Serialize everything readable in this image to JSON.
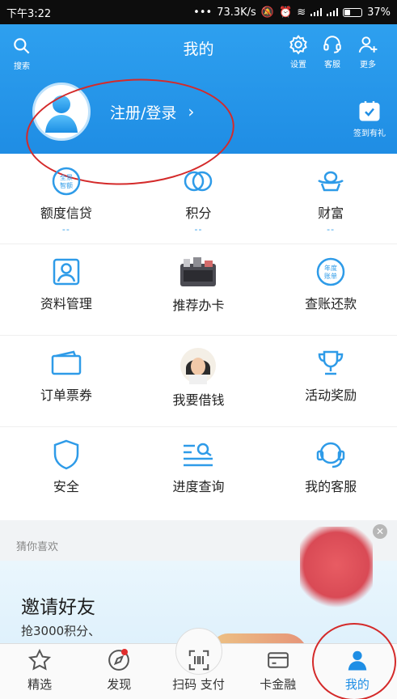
{
  "status_bar": {
    "time": "下午3:22",
    "speed": "73.3K/s",
    "battery": "37%"
  },
  "header": {
    "title": "我的",
    "search_label": "搜索",
    "settings_label": "设置",
    "service_label": "客服",
    "more_label": "更多",
    "login_text": "注册/登录",
    "checkin_label": "签到有礼"
  },
  "grid": {
    "row1": [
      {
        "label": "额度信贷",
        "sub": "--",
        "icon": "quanjing-credit-icon",
        "badge": "全景\n智额"
      },
      {
        "label": "积分",
        "sub": "--",
        "icon": "points-rings-icon"
      },
      {
        "label": "财富",
        "sub": "--",
        "icon": "ingot-icon"
      }
    ],
    "row2": [
      {
        "label": "资料管理",
        "icon": "profile-icon"
      },
      {
        "label": "推荐办卡",
        "icon": "recommend-card-photo-icon"
      },
      {
        "label": "查账还款",
        "icon": "annual-bill-icon",
        "badge": "年度\n账单"
      }
    ],
    "row3": [
      {
        "label": "订单票券",
        "icon": "ticket-icon"
      },
      {
        "label": "我要借钱",
        "icon": "borrow-photo-icon"
      },
      {
        "label": "活动奖励",
        "icon": "trophy-icon"
      }
    ],
    "row4": [
      {
        "label": "安全",
        "icon": "shield-icon"
      },
      {
        "label": "进度查询",
        "icon": "progress-query-icon"
      },
      {
        "label": "我的客服",
        "icon": "headset-icon"
      }
    ]
  },
  "recommend": {
    "title": "猜你喜欢",
    "banner_title": "邀请好友",
    "banner_sub": "抢3000积分、"
  },
  "tabbar": {
    "items": [
      {
        "label": "精选",
        "icon": "star-icon"
      },
      {
        "label": "发现",
        "icon": "compass-icon"
      },
      {
        "label": "扫码 支付",
        "icon": "scan-icon"
      },
      {
        "label": "卡金融",
        "icon": "card-icon"
      },
      {
        "label": "我的",
        "icon": "person-icon"
      }
    ]
  },
  "colors": {
    "accent": "#1f8de4",
    "highlight_ring": "#d42a2a"
  }
}
